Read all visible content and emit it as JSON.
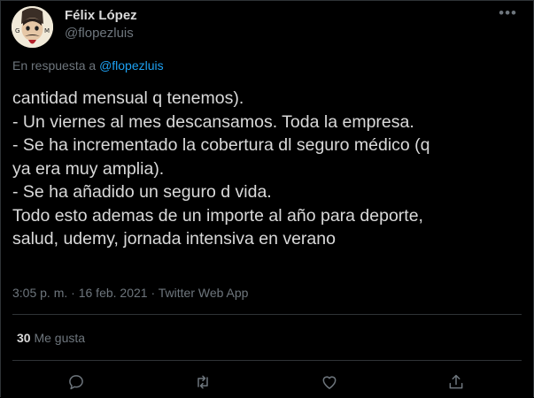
{
  "tweet": {
    "author": {
      "name": "Félix López",
      "handle": "@flopezluis",
      "avatar_text_left": "G",
      "avatar_text_right": "M"
    },
    "reply_to": {
      "prefix": "En respuesta a",
      "mention": "@flopezluis"
    },
    "text_lines": [
      "cantidad mensual q tenemos).",
      "- Un viernes al mes descansamos. Toda la empresa.",
      "- Se ha incrementado la cobertura dl seguro médico (q",
      "ya era muy amplia).",
      "- Se ha añadido un seguro d vida.",
      "Todo esto ademas de un importe al año para deporte,",
      "salud, udemy, jornada intensiva en verano"
    ],
    "time": "3:05 p. m.",
    "separator": "·",
    "date": "16 feb. 2021",
    "source": "Twitter Web App",
    "likes": {
      "count": "30",
      "label": "Me gusta"
    },
    "more_icon": "•••"
  },
  "actions": [
    {
      "name": "reply",
      "icon": "reply-icon"
    },
    {
      "name": "retweet",
      "icon": "retweet-icon"
    },
    {
      "name": "like",
      "icon": "heart-icon"
    },
    {
      "name": "share",
      "icon": "share-icon"
    }
  ],
  "colors": {
    "background": "#000000",
    "text": "#d9d9d9",
    "secondary": "#6e767d",
    "accent": "#1da1f2",
    "divider": "#2f3336"
  }
}
